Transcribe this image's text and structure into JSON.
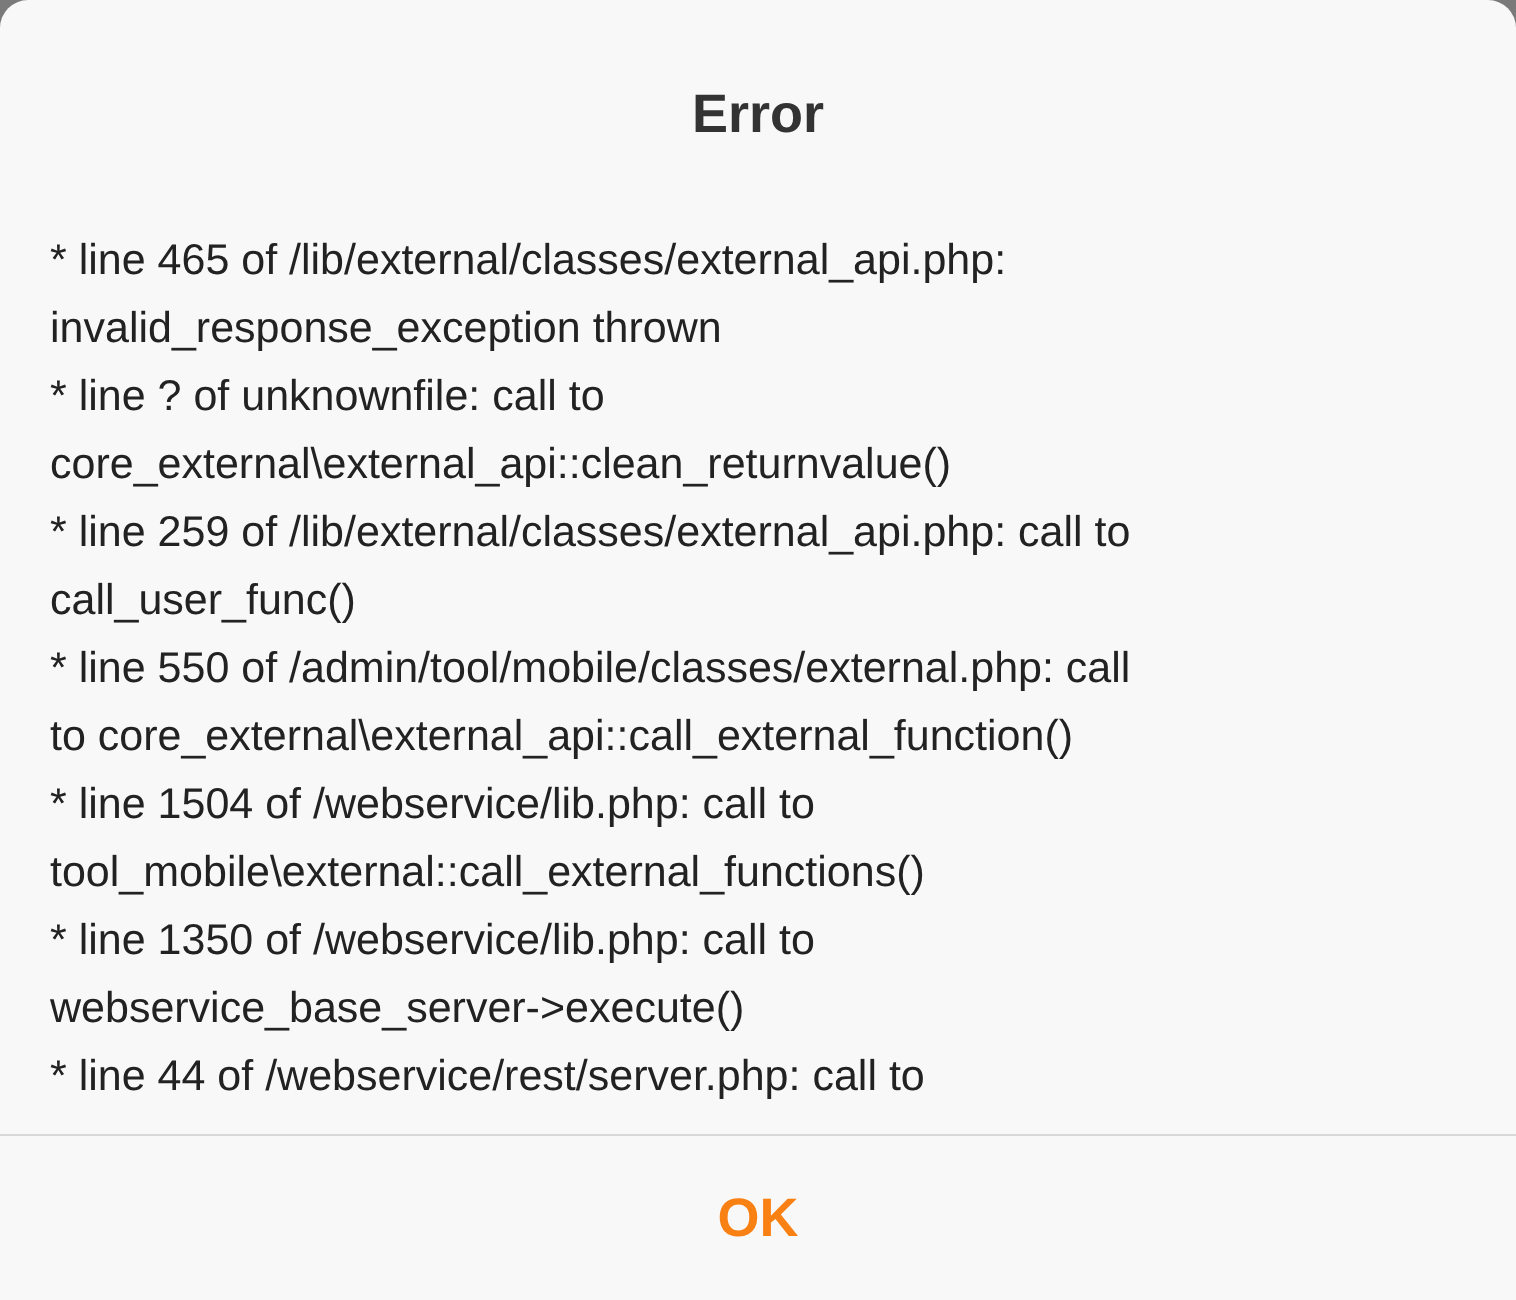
{
  "dialog": {
    "title": "Error",
    "message_lines": [
      "* line 465 of /lib/external/classes/external_api.php:",
      "invalid_response_exception thrown",
      "* line ? of unknownfile: call to",
      "core_external\\external_api::clean_returnvalue()",
      "* line 259 of /lib/external/classes/external_api.php: call to",
      "call_user_func()",
      "* line 550 of /admin/tool/mobile/classes/external.php: call",
      "to core_external\\external_api::call_external_function()",
      "* line 1504 of /webservice/lib.php: call to",
      "tool_mobile\\external::call_external_functions()",
      "* line 1350 of /webservice/lib.php: call to",
      "webservice_base_server->execute()",
      "* line 44 of /webservice/rest/server.php: call to"
    ],
    "buttons": [
      "OK"
    ]
  }
}
